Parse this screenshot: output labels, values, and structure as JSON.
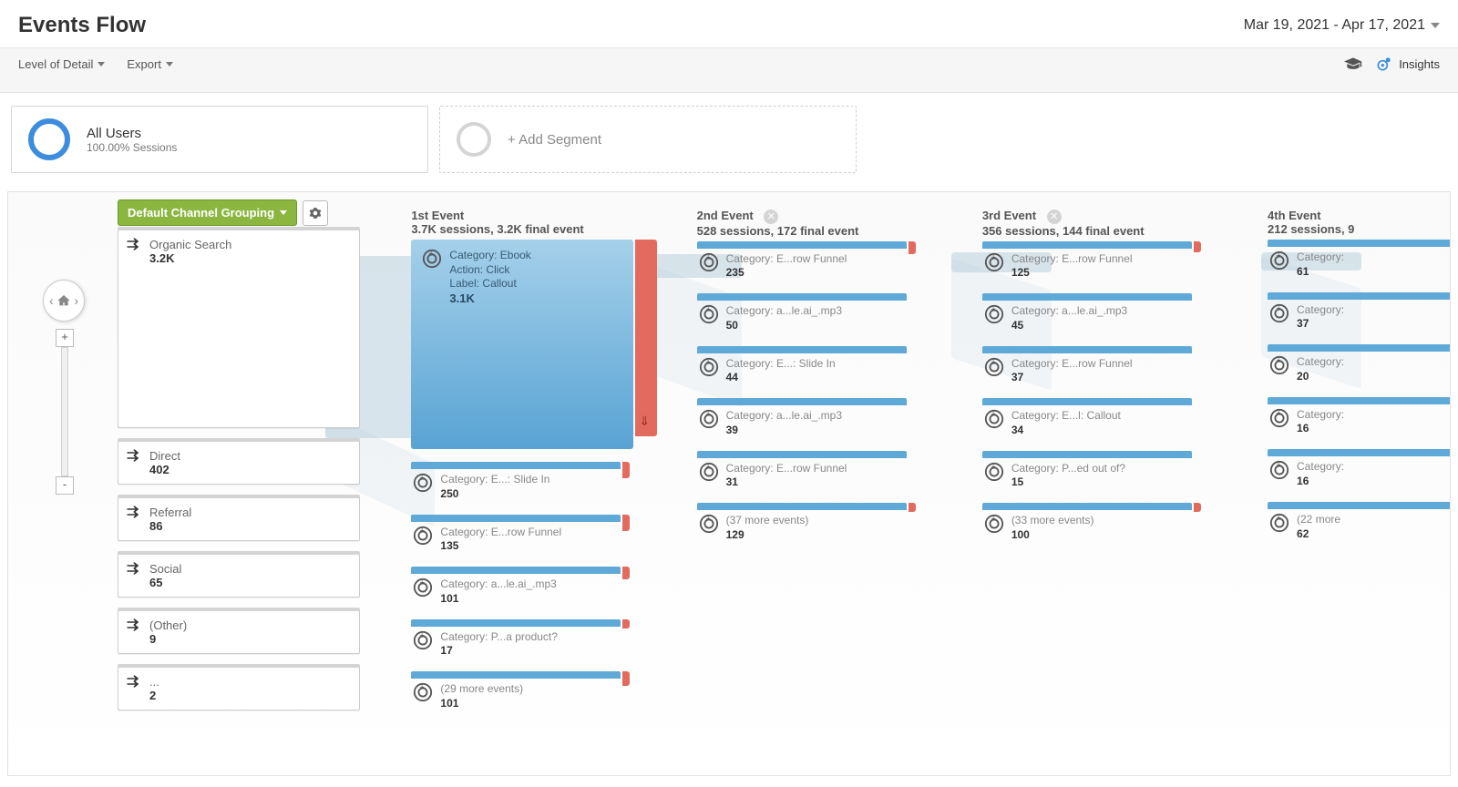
{
  "title": "Events Flow",
  "date_range": "Mar 19, 2021 - Apr 17, 2021",
  "toolbar": {
    "level_of_detail": "Level of Detail",
    "export": "Export",
    "insights": "Insights"
  },
  "segments": {
    "primary": {
      "name": "All Users",
      "detail": "100.00% Sessions"
    },
    "add_label": "+ Add Segment"
  },
  "flow": {
    "dimension_label": "Default Channel Grouping",
    "sources": [
      {
        "label": "Organic Search",
        "value": "3.2K",
        "tall": true
      },
      {
        "label": "Direct",
        "value": "402"
      },
      {
        "label": "Referral",
        "value": "86"
      },
      {
        "label": "Social",
        "value": "65"
      },
      {
        "label": "(Other)",
        "value": "9"
      },
      {
        "label": "...",
        "value": "2"
      }
    ],
    "columns": [
      {
        "title": "1st Event",
        "subtitle": "3.7K sessions, 3.2K final event",
        "closable": false,
        "nodes": [
          {
            "big": true,
            "lines": [
              "Category: Ebook",
              "Action: Click",
              "Label: Callout"
            ],
            "value": "3.1K",
            "dropoff_h": 216
          },
          {
            "label": "Category: E...: Slide In",
            "value": "250",
            "dropoff_h": 18
          },
          {
            "label": "Category: E...row Funnel",
            "value": "135",
            "dropoff_h": 18
          },
          {
            "label": "Category: a...le.ai_.mp3",
            "value": "101",
            "dropoff_h": 14
          },
          {
            "label": "Category: P...a product?",
            "value": "17",
            "dropoff_h": 10
          },
          {
            "label": "(29 more events)",
            "value": "101",
            "dropoff_h": 16
          }
        ]
      },
      {
        "title": "2nd Event",
        "subtitle": "528 sessions, 172 final event",
        "closable": true,
        "nodes": [
          {
            "label": "Category: E...row Funnel",
            "value": "235",
            "dropoff_h": 14
          },
          {
            "label": "Category: a...le.ai_.mp3",
            "value": "50"
          },
          {
            "label": "Category: E...: Slide In",
            "value": "44"
          },
          {
            "label": "Category: a...le.ai_.mp3",
            "value": "39"
          },
          {
            "label": "Category: E...row Funnel",
            "value": "31"
          },
          {
            "label": "(37 more events)",
            "value": "129",
            "dropoff_h": 10
          }
        ]
      },
      {
        "title": "3rd Event",
        "subtitle": "356 sessions, 144 final event",
        "closable": true,
        "nodes": [
          {
            "label": "Category: E...row Funnel",
            "value": "125",
            "dropoff_h": 12
          },
          {
            "label": "Category: a...le.ai_.mp3",
            "value": "45"
          },
          {
            "label": "Category: E...row Funnel",
            "value": "37"
          },
          {
            "label": "Category: E...l: Callout",
            "value": "34"
          },
          {
            "label": "Category: P...ed out of?",
            "value": "15"
          },
          {
            "label": "(33 more events)",
            "value": "100",
            "dropoff_h": 10
          }
        ]
      },
      {
        "title": "4th Event",
        "subtitle": "212 sessions, 9",
        "closable": false,
        "nodes": [
          {
            "label": "Category:",
            "value": "61"
          },
          {
            "label": "Category:",
            "value": "37"
          },
          {
            "label": "Category:",
            "value": "20"
          },
          {
            "label": "Category:",
            "value": "16"
          },
          {
            "label": "Category:",
            "value": "16"
          },
          {
            "label": "(22 more",
            "value": "62"
          }
        ]
      }
    ]
  }
}
